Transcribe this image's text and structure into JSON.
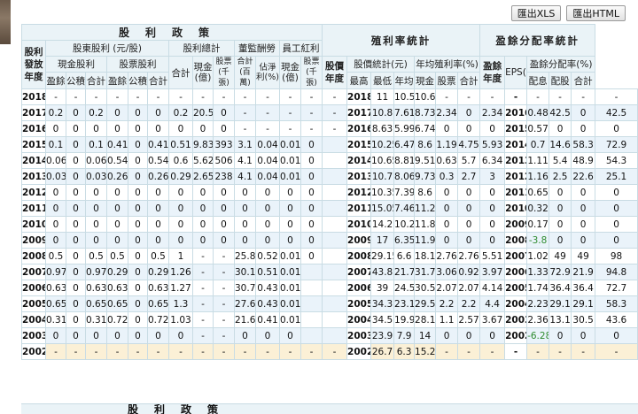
{
  "toolbar": {
    "export_xls": "匯出XLS",
    "export_html": "匯出HTML"
  },
  "headers": {
    "group_dividend": "股利政策",
    "group_yield": "殖利率統計",
    "group_payout": "盈餘分配率統計",
    "year_div": "股利發放年度",
    "shareholder_div": "股東股利 (元/股)",
    "total_div": "股利總計",
    "director_comp": "董監酬勞",
    "employee_bonus": "員工紅利",
    "cash_div": "現金股利",
    "stock_div": "股票股利",
    "surplus": "盈餘",
    "reserve": "公積",
    "subtotal": "合計",
    "total": "合計",
    "cash_100m": "現金(億)",
    "stock_k": "股票(千張)",
    "total_million": "合計(百萬)",
    "net_pct": "佔淨利(%)",
    "year_price": "股價年度",
    "price_stats": "股價統計(元)",
    "yield_pct": "年均殖利率(%)",
    "high": "最高",
    "low": "最低",
    "avg": "年均",
    "cash": "現金",
    "stock": "股票",
    "year_earn": "盈餘年度",
    "eps": "EPS(元)",
    "payout_pct": "盈餘分配率(%)",
    "pay_cash": "配息",
    "pay_stock": "配股"
  },
  "rows": [
    [
      "2018",
      "-",
      "-",
      "-",
      "-",
      "-",
      "-",
      "-",
      "-",
      "-",
      "-",
      "-",
      "-",
      "-",
      "-",
      "2018",
      "11",
      "10.5",
      "10.6",
      "-",
      "-",
      "-",
      "-",
      "-",
      "-",
      "-",
      "-"
    ],
    [
      "2017",
      "0.2",
      "0",
      "0.2",
      "0",
      "0",
      "0",
      "0.2",
      "20.5",
      "0",
      "-",
      "-",
      "-",
      "-",
      "-",
      "2017",
      "10.8",
      "7.61",
      "8.73",
      "2.34",
      "0",
      "2.34",
      "2016",
      "0.48",
      "42.5",
      "0",
      "42.5"
    ],
    [
      "2016",
      "0",
      "0",
      "0",
      "0",
      "0",
      "0",
      "0",
      "0",
      "0",
      "-",
      "-",
      "-",
      "-",
      "-",
      "2016",
      "8.63",
      "5.99",
      "6.74",
      "0",
      "0",
      "0",
      "2015",
      "0.57",
      "0",
      "0",
      "0"
    ],
    [
      "2015",
      "0.1",
      "0",
      "0.1",
      "0.41",
      "0",
      "0.41",
      "0.51",
      "9.83",
      "393",
      "3.1",
      "0.04",
      "0.01",
      "0",
      "",
      "2015",
      "10.25",
      "6.47",
      "8.6",
      "1.19",
      "4.75",
      "5.93",
      "2014",
      "0.7",
      "14.6",
      "58.3",
      "72.9"
    ],
    [
      "2014",
      "0.06",
      "0",
      "0.06",
      "0.54",
      "0",
      "0.54",
      "0.6",
      "5.62",
      "506",
      "4.1",
      "0.04",
      "0.01",
      "0",
      "",
      "2014",
      "10.65",
      "8.81",
      "9.51",
      "0.63",
      "5.7",
      "6.34",
      "2013",
      "1.11",
      "5.4",
      "48.9",
      "54.3"
    ],
    [
      "2013",
      "0.03",
      "0",
      "0.03",
      "0.26",
      "0",
      "0.26",
      "0.29",
      "2.65",
      "238",
      "4.1",
      "0.04",
      "0.01",
      "0",
      "",
      "2013",
      "10.7",
      "8.06",
      "9.73",
      "0.3",
      "2.7",
      "3",
      "2012",
      "1.16",
      "2.5",
      "22.6",
      "25.1"
    ],
    [
      "2012",
      "0",
      "0",
      "0",
      "0",
      "0",
      "0",
      "0",
      "0",
      "0",
      "0",
      "0",
      "0",
      "0",
      "",
      "2012",
      "10.35",
      "7.39",
      "8.6",
      "0",
      "0",
      "0",
      "2011",
      "0.65",
      "0",
      "0",
      "0"
    ],
    [
      "2011",
      "0",
      "0",
      "0",
      "0",
      "0",
      "0",
      "0",
      "0",
      "0",
      "0",
      "0",
      "0",
      "0",
      "",
      "2011",
      "15.05",
      "7.46",
      "11.2",
      "0",
      "0",
      "0",
      "2010",
      "0.32",
      "0",
      "0",
      "0"
    ],
    [
      "2010",
      "0",
      "0",
      "0",
      "0",
      "0",
      "0",
      "0",
      "0",
      "0",
      "0",
      "0",
      "0",
      "0",
      "",
      "2010",
      "14.2",
      "10.25",
      "11.8",
      "0",
      "0",
      "0",
      "2009",
      "0.17",
      "0",
      "0",
      "0"
    ],
    [
      "2009",
      "0",
      "0",
      "0",
      "0",
      "0",
      "0",
      "0",
      "0",
      "0",
      "0",
      "0",
      "0",
      "0",
      "",
      "2009",
      "17",
      "6.35",
      "11.9",
      "0",
      "0",
      "0",
      "2008",
      "-3.8",
      "0",
      "0",
      "0"
    ],
    [
      "2008",
      "0.5",
      "0",
      "0.5",
      "0.5",
      "0",
      "0.5",
      "1",
      "-",
      "-",
      "25.8",
      "0.52",
      "0.01",
      "0",
      "",
      "2008",
      "29.15",
      "6.6",
      "18.1",
      "2.76",
      "2.76",
      "5.51",
      "2007",
      "1.02",
      "49",
      "49",
      "98"
    ],
    [
      "2007",
      "0.97",
      "0",
      "0.97",
      "0.29",
      "0",
      "0.29",
      "1.26",
      "-",
      "-",
      "30.1",
      "0.51",
      "0.01",
      "",
      "",
      "2007",
      "43.8",
      "21.7",
      "31.7",
      "3.06",
      "0.92",
      "3.97",
      "2006",
      "1.33",
      "72.9",
      "21.9",
      "94.8"
    ],
    [
      "2006",
      "0.63",
      "0",
      "0.63",
      "0.63",
      "0",
      "0.63",
      "1.27",
      "-",
      "-",
      "30.7",
      "0.43",
      "0.01",
      "",
      "",
      "2006",
      "39",
      "24.5",
      "30.5",
      "2.07",
      "2.07",
      "4.14",
      "2005",
      "1.74",
      "36.4",
      "36.4",
      "72.7"
    ],
    [
      "2005",
      "0.65",
      "0",
      "0.65",
      "0.65",
      "0",
      "0.65",
      "1.3",
      "-",
      "-",
      "27.6",
      "0.43",
      "0.01",
      "",
      "",
      "2005",
      "34.3",
      "23.15",
      "29.5",
      "2.2",
      "2.2",
      "4.4",
      "2004",
      "2.23",
      "29.1",
      "29.1",
      "58.3"
    ],
    [
      "2004",
      "0.31",
      "0",
      "0.31",
      "0.72",
      "0",
      "0.72",
      "1.03",
      "-",
      "-",
      "21.6",
      "0.41",
      "0.01",
      "",
      "",
      "2004",
      "34.5",
      "19.9",
      "28.1",
      "1.1",
      "2.57",
      "3.67",
      "2003",
      "2.36",
      "13.1",
      "30.5",
      "43.6"
    ],
    [
      "2003",
      "0",
      "0",
      "0",
      "0",
      "0",
      "0",
      "0",
      "-",
      "-",
      "0",
      "0",
      "0",
      "",
      "",
      "2003",
      "23.9",
      "7.9",
      "14",
      "0",
      "0",
      "0",
      "2002",
      "-6.28",
      "0",
      "0",
      "0"
    ],
    [
      "2002",
      "-",
      "-",
      "-",
      "-",
      "-",
      "-",
      "-",
      "-",
      "-",
      "-",
      "-",
      "-",
      "-",
      "-",
      "2002",
      "26.7",
      "6.3",
      "15.2",
      "-",
      "-",
      "-",
      "-",
      "-",
      "-",
      "-",
      "-"
    ]
  ],
  "footer": {
    "repeat_title": "股利政策"
  }
}
